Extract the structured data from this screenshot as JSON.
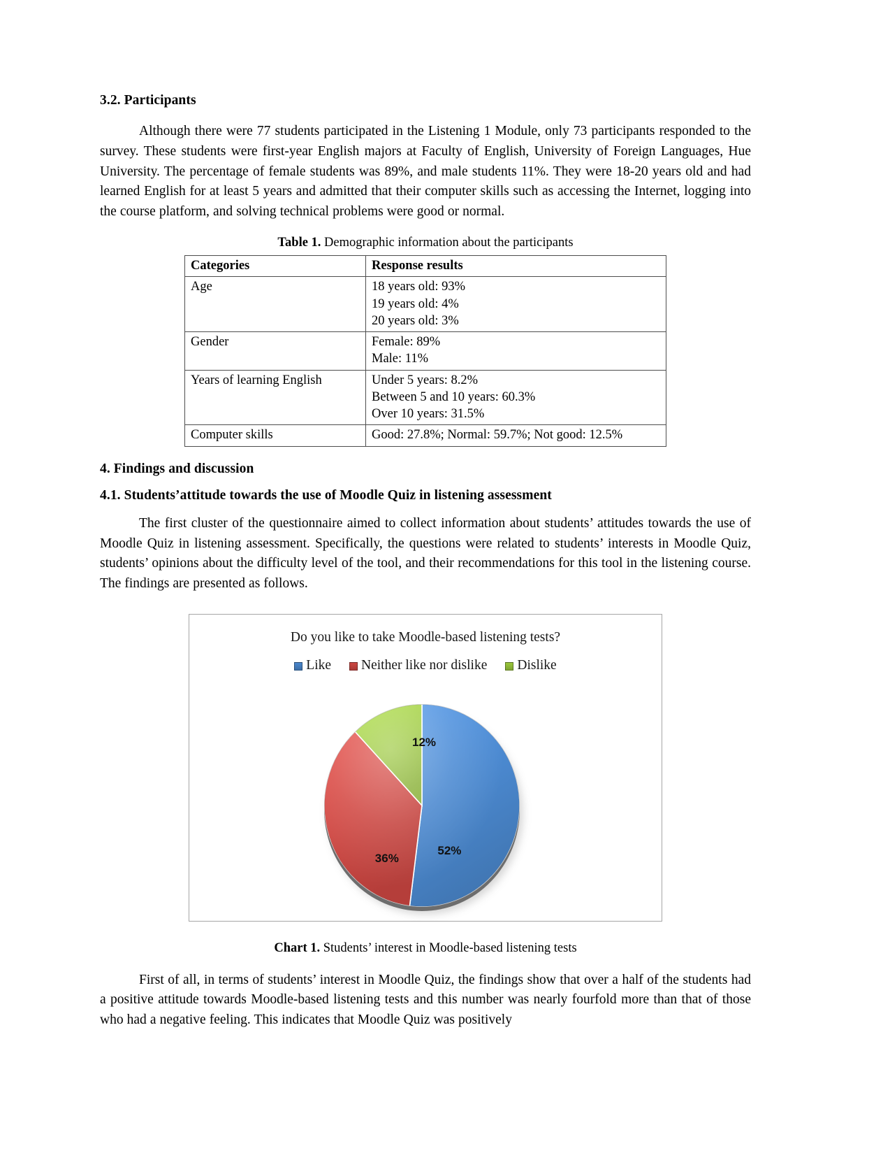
{
  "section": {
    "participants_heading": "3.2. Participants",
    "participants_paragraph": "Although there were 77 students participated in the Listening 1 Module, only 73 participants responded to the survey. These students were first-year English majors at Faculty of English, University of Foreign Languages, Hue University. The percentage of female students was 89%, and male students 11%. They were 18-20 years old and had learned English for at least 5 years and admitted that their computer skills such as accessing the Internet, logging into the course platform, and solving technical problems were good or normal.",
    "findings_heading": "4. Findings and discussion",
    "attitude_heading": "4.1. Students’attitude towards the use of Moodle Quiz in listening assessment",
    "attitude_paragraph": "The first cluster of the questionnaire aimed to collect information about students’ attitudes towards the use of Moodle Quiz in listening assessment. Specifically, the questions were related to students’ interests in Moodle Quiz, students’ opinions about the difficulty level of the tool, and their recommendations for this tool in the listening course. The findings are presented as follows.",
    "closing_paragraph": "First of all, in terms of students’ interest in Moodle Quiz, the findings show that over a half of the students had a positive attitude towards Moodle-based listening tests and this number was nearly fourfold more than that of those who had a negative feeling. This indicates that Moodle Quiz was positively"
  },
  "table": {
    "caption_label": "Table 1.",
    "caption_text": " Demographic information about the participants",
    "headers": [
      "Categories",
      "Response results"
    ],
    "rows": [
      {
        "category": "Age",
        "values": [
          "18 years old: 93%",
          "19 years old: 4%",
          "20 years old: 3%"
        ]
      },
      {
        "category": "Gender",
        "values": [
          "Female: 89%",
          "Male: 11%"
        ]
      },
      {
        "category": "Years of learning English",
        "values": [
          "Under 5 years: 8.2%",
          "Between 5 and 10 years: 60.3%",
          "Over 10 years: 31.5%"
        ]
      },
      {
        "category": "Computer skills",
        "values": [
          "Good: 27.8%; Normal: 59.7%; Not good: 12.5%"
        ]
      }
    ]
  },
  "figure": {
    "caption_label": "Chart 1.",
    "caption_text": " Students’ interest in Moodle-based listening tests"
  },
  "chart_data": {
    "type": "pie",
    "title": "Do you like to take Moodle-based listening tests?",
    "categories": [
      "Like",
      "Neither like nor dislike",
      "Dislike"
    ],
    "values": [
      52,
      36,
      12
    ],
    "data_labels": [
      "52%",
      "36%",
      "12%"
    ],
    "colors": [
      "#4A87CD",
      "#CE4742",
      "#9BC83C"
    ],
    "legend_position": "top",
    "grid": false,
    "start_angle_deg": 0,
    "direction": "clockwise",
    "unit": "%"
  }
}
